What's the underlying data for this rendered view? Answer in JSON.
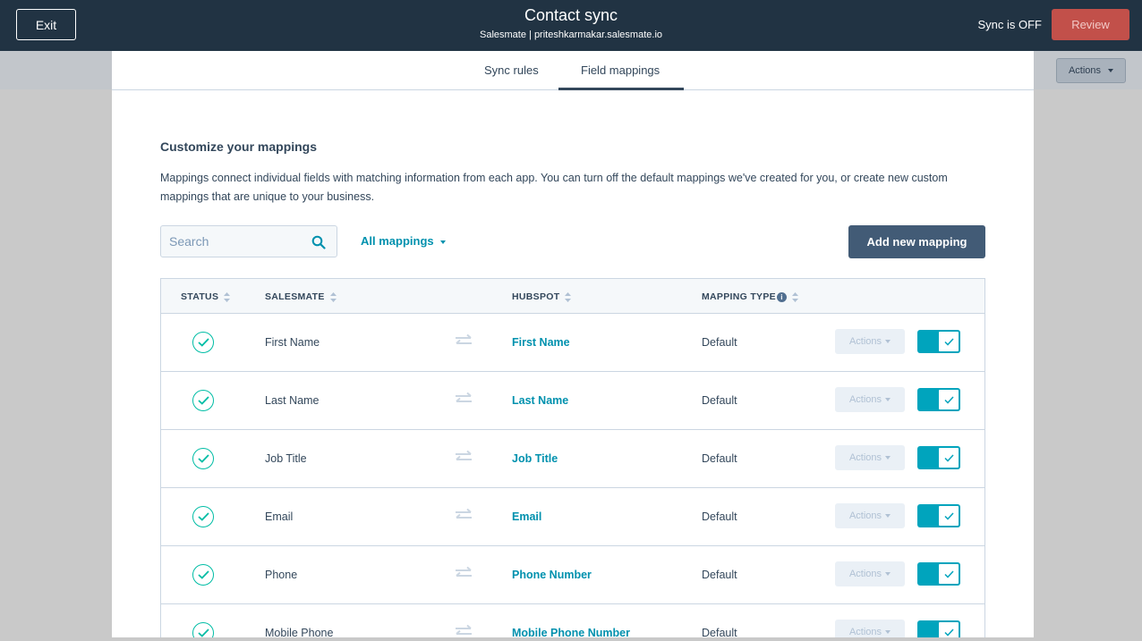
{
  "header": {
    "exit_label": "Exit",
    "title": "Contact sync",
    "subtitle": "Salesmate | priteshkarmakar.salesmate.io",
    "sync_status": "Sync is OFF",
    "review_label": "Review"
  },
  "background": {
    "actions_label": "Actions"
  },
  "tabs": [
    {
      "label": "Sync rules",
      "active": false
    },
    {
      "label": "Field mappings",
      "active": true
    }
  ],
  "section": {
    "title": "Customize your mappings",
    "description": "Mappings connect individual fields with matching information from each app. You can turn off the default mappings we've created for you, or create new custom mappings that are unique to your business."
  },
  "toolbar": {
    "search_placeholder": "Search",
    "filter_label": "All mappings",
    "add_label": "Add new mapping"
  },
  "table": {
    "columns": {
      "status": "STATUS",
      "salesmate": "SALESMATE",
      "hubspot": "HUBSPOT",
      "type": "MAPPING TYPE"
    },
    "rows": [
      {
        "salesmate": "First Name",
        "hubspot": "First Name",
        "type": "Default",
        "actions": "Actions"
      },
      {
        "salesmate": "Last Name",
        "hubspot": "Last Name",
        "type": "Default",
        "actions": "Actions"
      },
      {
        "salesmate": "Job Title",
        "hubspot": "Job Title",
        "type": "Default",
        "actions": "Actions"
      },
      {
        "salesmate": "Email",
        "hubspot": "Email",
        "type": "Default",
        "actions": "Actions"
      },
      {
        "salesmate": "Phone",
        "hubspot": "Phone Number",
        "type": "Default",
        "actions": "Actions"
      },
      {
        "salesmate": "Mobile Phone",
        "hubspot": "Mobile Phone Number",
        "type": "Default",
        "actions": "Actions"
      }
    ]
  },
  "colors": {
    "header_bg": "#213343",
    "review": "#c2504a",
    "accent_teal": "#00a4bd",
    "link": "#0091ae",
    "primary_btn": "#425b76"
  }
}
